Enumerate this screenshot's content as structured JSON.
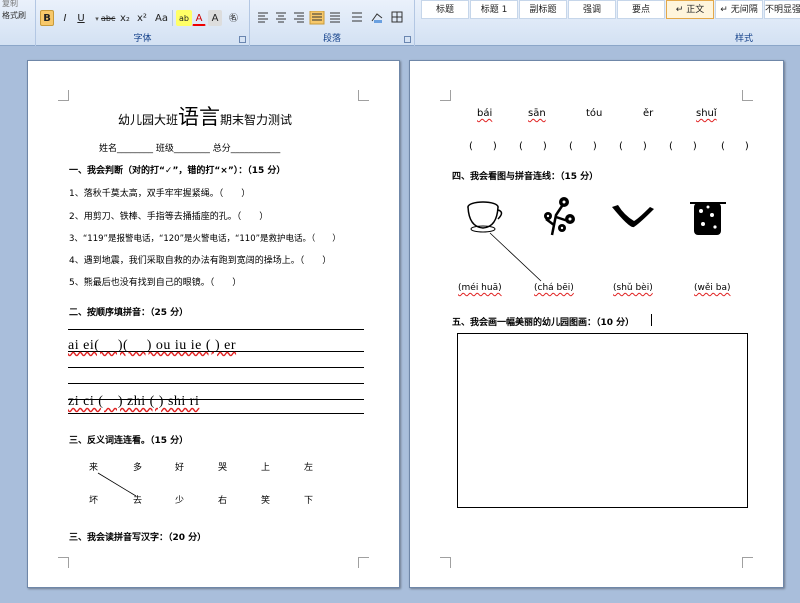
{
  "ribbon": {
    "left_items": [
      "复制",
      "格式刷"
    ],
    "font_buttons": [
      "B",
      "I",
      "U",
      "abc",
      "x₂",
      "x²",
      "Aa",
      "ab",
      "A",
      "A",
      "㊔"
    ],
    "font_group_label": "字体",
    "paragraph_group_label": "段落",
    "styles": [
      "标题",
      "标题 1",
      "副标题",
      "强调",
      "要点",
      "↵ 正文",
      "↵ 无间隔",
      "不明显强调"
    ],
    "styles_group_label": "样式"
  },
  "page1": {
    "title_pre": "幼儿园大班",
    "title_big": "语言",
    "title_post": "期末智力测试",
    "info_line": "姓名________ 班级________ 总分___________",
    "sec1": "一、我会判断（对的打“✓”，错的打“×”）：（15 分）",
    "q1": "1、落秋千莫太高，双手牢牢握紧绳。（　　）",
    "q2": "2、用剪刀、铁棒、手指等去捅插座的孔。（　　）",
    "q3": "3、“119”是报警电话，“120”是火警电话，“110”是救护电话。（　　）",
    "q4": "4、遇到地震，我们采取自救的办法有跑到宽阔的操场上。（　　）",
    "q5": "5、熊最后也没有找到自己的眼镜。（　　）",
    "sec2": "二、按顺序填拼音：（25 分）",
    "pinyin_row1": "ai ei(　 )(　 ) ou iu  ie ( ) er",
    "pinyin_row2": "zi ci (　) zhi ( ) shi  ri",
    "sec3": "三、反义词连连看。（15 分）",
    "antonyms_top": [
      "来",
      "多",
      "好",
      "哭",
      "上",
      "左"
    ],
    "antonyms_bottom": [
      "坏",
      "去",
      "少",
      "右",
      "笑",
      "下"
    ],
    "sec4": "三、我会读拼音写汉字：（20 分）"
  },
  "page2": {
    "pinyin_words": [
      "bái",
      "sān",
      "tóu",
      "ěr",
      "shuǐ"
    ],
    "answer_slots": [
      "(　　)",
      "(　　)",
      "(　　)",
      "(　　)",
      "(　　)",
      "(　　)"
    ],
    "sec4": "四、我会看图与拼音连线：（15 分）",
    "picture_icons": [
      "teacup-icon",
      "plum-blossom-icon",
      "boomerang-icon",
      "backpack-icon"
    ],
    "picture_pinyin": [
      "(méi huā)",
      "(chá bēi)",
      "(shǔ bèi)",
      "(wěi ba)"
    ],
    "sec5": "五、我会画一幅美丽的幼儿园图画：（10 分）"
  }
}
